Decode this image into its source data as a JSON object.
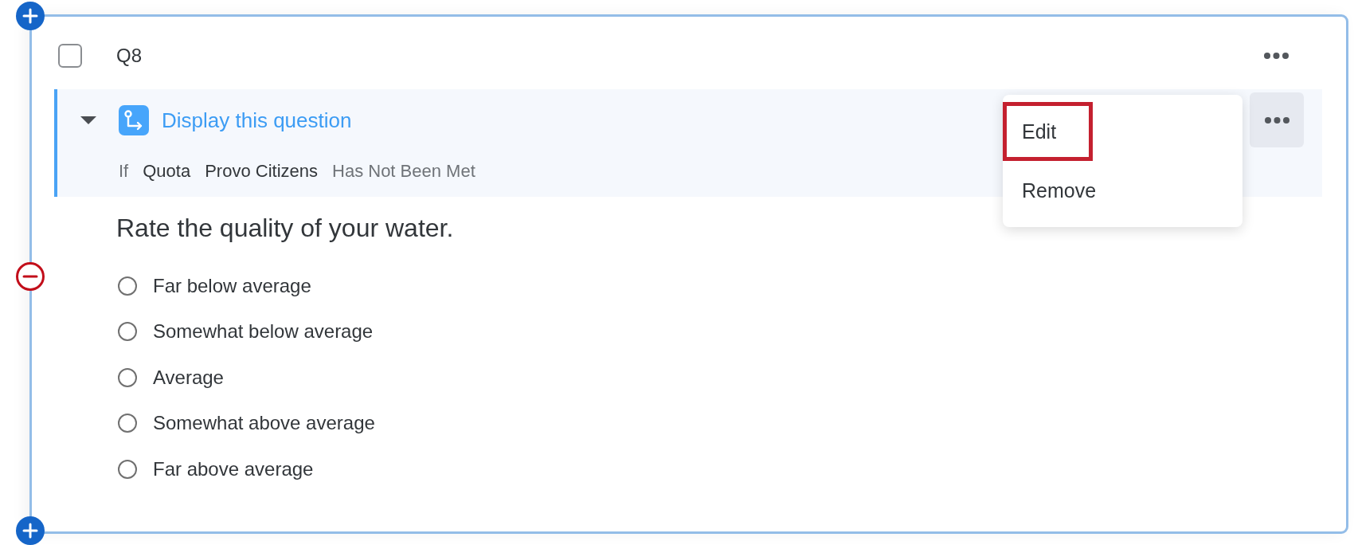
{
  "question": {
    "number": "Q8",
    "checked": false
  },
  "display_logic": {
    "expanded": true,
    "title": "Display this question",
    "condition": [
      {
        "text": "If",
        "kind": "keyword"
      },
      {
        "text": "Quota",
        "kind": "value"
      },
      {
        "text": "Provo Citizens",
        "kind": "value"
      },
      {
        "text": "Has Not Been Met",
        "kind": "operator"
      }
    ]
  },
  "question_text": "Rate the quality of your water.",
  "choices": [
    {
      "label": "Far below average",
      "selected": false
    },
    {
      "label": "Somewhat below average",
      "selected": false
    },
    {
      "label": "Average",
      "selected": false
    },
    {
      "label": "Somewhat above average",
      "selected": false
    },
    {
      "label": "Far above average",
      "selected": false
    }
  ],
  "menu": {
    "items": [
      {
        "label": "Edit",
        "highlighted": true
      },
      {
        "label": "Remove",
        "highlighted": false
      }
    ]
  }
}
